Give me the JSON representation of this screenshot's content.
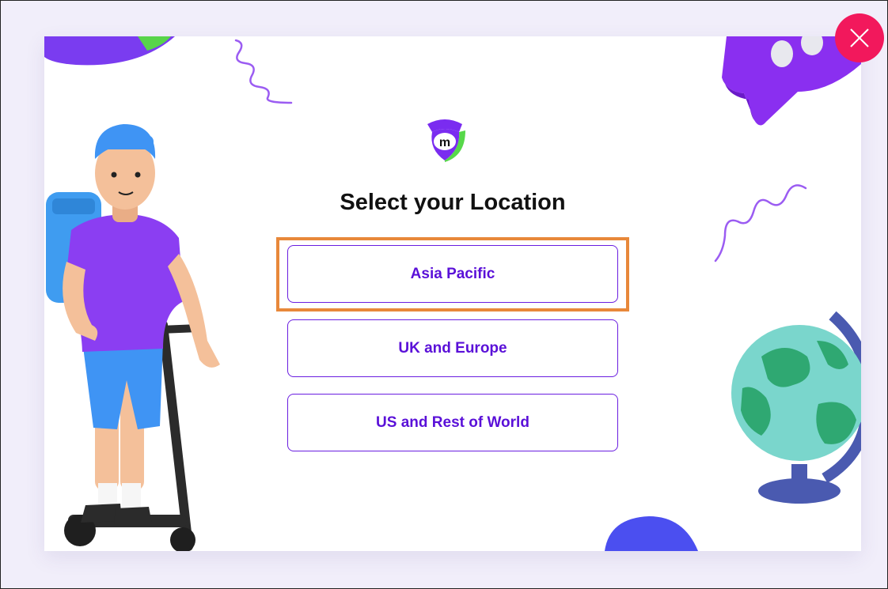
{
  "dialog": {
    "title": "Select your Location",
    "logo_icon": "m-logo-icon",
    "close_icon": "close-icon"
  },
  "locations": [
    {
      "label": "Asia Pacific",
      "highlighted": true
    },
    {
      "label": "UK and Europe",
      "highlighted": false
    },
    {
      "label": "US and Rest of World",
      "highlighted": false
    }
  ],
  "colors": {
    "accent": "#5a10d8",
    "close_button": "#f2185c",
    "highlight": "#e8883a",
    "background": "#f1eefa"
  }
}
